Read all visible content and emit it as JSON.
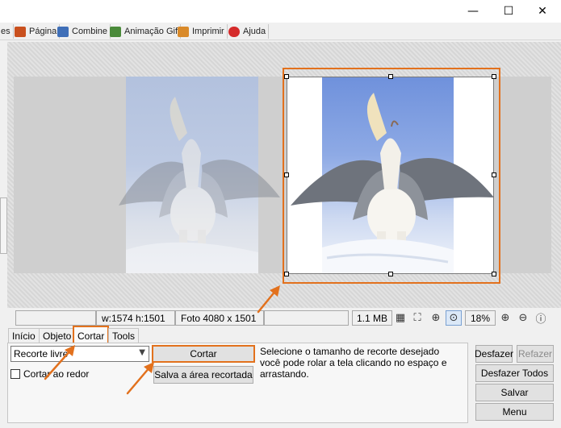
{
  "window": {
    "minimize": "—",
    "maximize": "☐",
    "close": "✕"
  },
  "menu": [
    {
      "label": "es",
      "icon": ""
    },
    {
      "label": "Página",
      "icon": "page-icon"
    },
    {
      "label": "Combine",
      "icon": "combine-icon"
    },
    {
      "label": "Animação Gif",
      "icon": "gif-animation-icon"
    },
    {
      "label": "Imprimir",
      "icon": "print-icon"
    },
    {
      "label": "Ajuda",
      "icon": "help-icon"
    }
  ],
  "status": {
    "dimensions": "w:1574 h:1501",
    "photo": "Foto 4080 x 1501",
    "size": "1.1 MB",
    "zoom": "18%"
  },
  "tabs": [
    "Início",
    "Objeto",
    "Cortar",
    "Tools"
  ],
  "active_tab": "Cortar",
  "crop": {
    "mode": "Recorte livre",
    "crop_around": "Cortar ao redor",
    "crop_button": "Cortar",
    "save_button": "Salva a área recortada",
    "description": "Selecione o tamanho de recorte desejado você pode rolar a tela clicando no espaço e arrastando."
  },
  "actions": {
    "undo": "Desfazer",
    "redo": "Refazer",
    "undo_all": "Desfazer Todos",
    "save": "Salvar",
    "menu": "Menu"
  },
  "colors": {
    "highlight": "#e2711d",
    "sky": "#6f91dc"
  }
}
